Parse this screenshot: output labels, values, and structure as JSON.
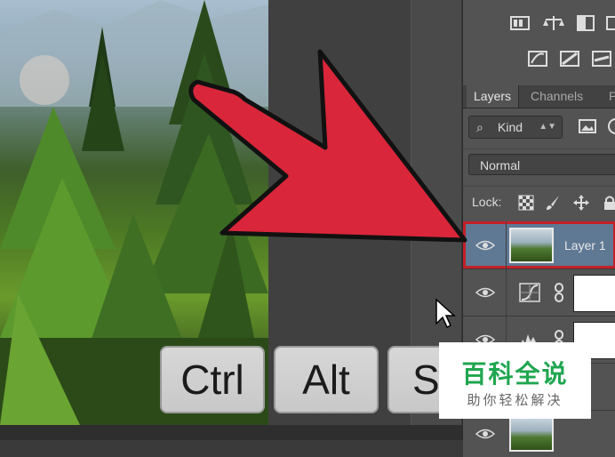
{
  "panel": {
    "tabs": [
      {
        "label": "Layers"
      },
      {
        "label": "Channels"
      },
      {
        "label": "P"
      }
    ],
    "filter": {
      "kind_label": "Kind"
    },
    "blend_mode": "Normal",
    "lock_label": "Lock:",
    "layers": [
      {
        "name": "Layer 1",
        "selected": true
      }
    ]
  },
  "keys": [
    "Ctrl",
    "Alt",
    "S"
  ],
  "watermark": {
    "main": "百科全说",
    "sub": "助你轻松解决"
  },
  "colors": {
    "arrow": "#d9263a",
    "highlight": "#c42028",
    "watermark_green": "#1fa64f",
    "selected_layer": "#5f7894"
  }
}
